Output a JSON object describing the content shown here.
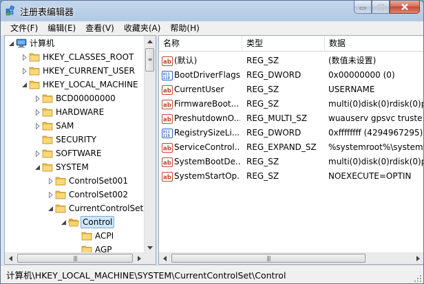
{
  "window": {
    "title": "注册表编辑器"
  },
  "menu": [
    "文件(F)",
    "编辑(E)",
    "查看(V)",
    "收藏夹(A)",
    "帮助(H)"
  ],
  "tree": [
    {
      "label": "计算机",
      "level": 0,
      "expanded": true,
      "icon": "computer-icon"
    },
    {
      "label": "HKEY_CLASSES_ROOT",
      "level": 1,
      "expanded": false,
      "icon": "folder-icon"
    },
    {
      "label": "HKEY_CURRENT_USER",
      "level": 1,
      "expanded": false,
      "icon": "folder-icon"
    },
    {
      "label": "HKEY_LOCAL_MACHINE",
      "level": 1,
      "expanded": true,
      "icon": "folder-icon"
    },
    {
      "label": "BCD00000000",
      "level": 2,
      "expanded": false,
      "icon": "folder-icon"
    },
    {
      "label": "HARDWARE",
      "level": 2,
      "expanded": false,
      "icon": "folder-icon"
    },
    {
      "label": "SAM",
      "level": 2,
      "expanded": false,
      "icon": "folder-icon"
    },
    {
      "label": "SECURITY",
      "level": 2,
      "expanded": null,
      "icon": "folder-icon"
    },
    {
      "label": "SOFTWARE",
      "level": 2,
      "expanded": false,
      "icon": "folder-icon"
    },
    {
      "label": "SYSTEM",
      "level": 2,
      "expanded": true,
      "icon": "folder-icon"
    },
    {
      "label": "ControlSet001",
      "level": 3,
      "expanded": false,
      "icon": "folder-icon"
    },
    {
      "label": "ControlSet002",
      "level": 3,
      "expanded": false,
      "icon": "folder-icon"
    },
    {
      "label": "CurrentControlSet",
      "level": 3,
      "expanded": true,
      "icon": "folder-icon"
    },
    {
      "label": "Control",
      "level": 4,
      "expanded": true,
      "icon": "folder-open-icon",
      "selected": true
    },
    {
      "label": "ACPI",
      "level": 5,
      "expanded": null,
      "icon": "folder-icon"
    },
    {
      "label": "AGP",
      "level": 5,
      "expanded": null,
      "icon": "folder-icon"
    }
  ],
  "columns": [
    "名称",
    "类型",
    "数据"
  ],
  "values": [
    {
      "name": "(默认)",
      "type": "REG_SZ",
      "data": "(数值未设置)",
      "icon": "string-value-icon"
    },
    {
      "name": "BootDriverFlags",
      "type": "REG_DWORD",
      "data": "0x00000000 (0)",
      "icon": "binary-value-icon"
    },
    {
      "name": "CurrentUser",
      "type": "REG_SZ",
      "data": "USERNAME",
      "icon": "string-value-icon"
    },
    {
      "name": "FirmwareBoot...",
      "type": "REG_SZ",
      "data": "multi(0)disk(0)rdisk(0)p",
      "icon": "string-value-icon"
    },
    {
      "name": "PreshutdownO...",
      "type": "REG_MULTI_SZ",
      "data": "wuauserv gpsvc truste",
      "icon": "string-value-icon"
    },
    {
      "name": "RegistrySizeLi...",
      "type": "REG_DWORD",
      "data": "0xffffffff (4294967295)",
      "icon": "binary-value-icon"
    },
    {
      "name": "ServiceControl...",
      "type": "REG_EXPAND_SZ",
      "data": "%systemroot%\\system",
      "icon": "string-value-icon"
    },
    {
      "name": "SystemBootDe...",
      "type": "REG_SZ",
      "data": "multi(0)disk(0)rdisk(0)p",
      "icon": "string-value-icon"
    },
    {
      "name": "SystemStartOp...",
      "type": "REG_SZ",
      "data": " NOEXECUTE=OPTIN",
      "icon": "string-value-icon"
    }
  ],
  "status": {
    "path": "计算机\\HKEY_LOCAL_MACHINE\\SYSTEM\\CurrentControlSet\\Control"
  }
}
